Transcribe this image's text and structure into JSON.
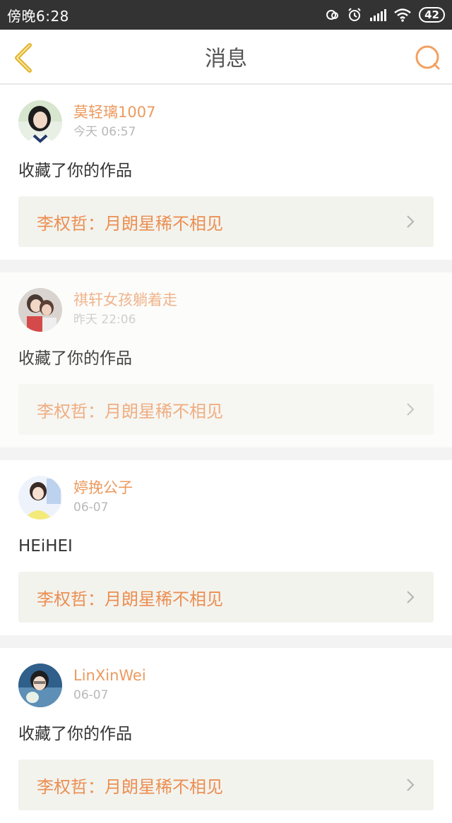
{
  "status_bar": {
    "time": "傍晚6:28",
    "battery": "42"
  },
  "header": {
    "title": "消息"
  },
  "messages": [
    {
      "user": "莫轻璃1007",
      "time": "今天 06:57",
      "text": "收藏了你的作品",
      "work": "李权哲：月朗星稀不相见"
    },
    {
      "user": "祺轩女孩躺着走",
      "time": "昨天 22:06",
      "text": "收藏了你的作品",
      "work": "李权哲：月朗星稀不相见"
    },
    {
      "user": "婷挽公子",
      "time": "06-07",
      "text": "HEiHEI",
      "work": "李权哲：月朗星稀不相见"
    },
    {
      "user": "LinXinWei",
      "time": "06-07",
      "text": "收藏了你的作品",
      "work": "李权哲：月朗星稀不相见"
    }
  ],
  "colors": {
    "accent": "#ec9a5f",
    "back_arrow": "#e2b42a",
    "status_bg": "#333333"
  }
}
